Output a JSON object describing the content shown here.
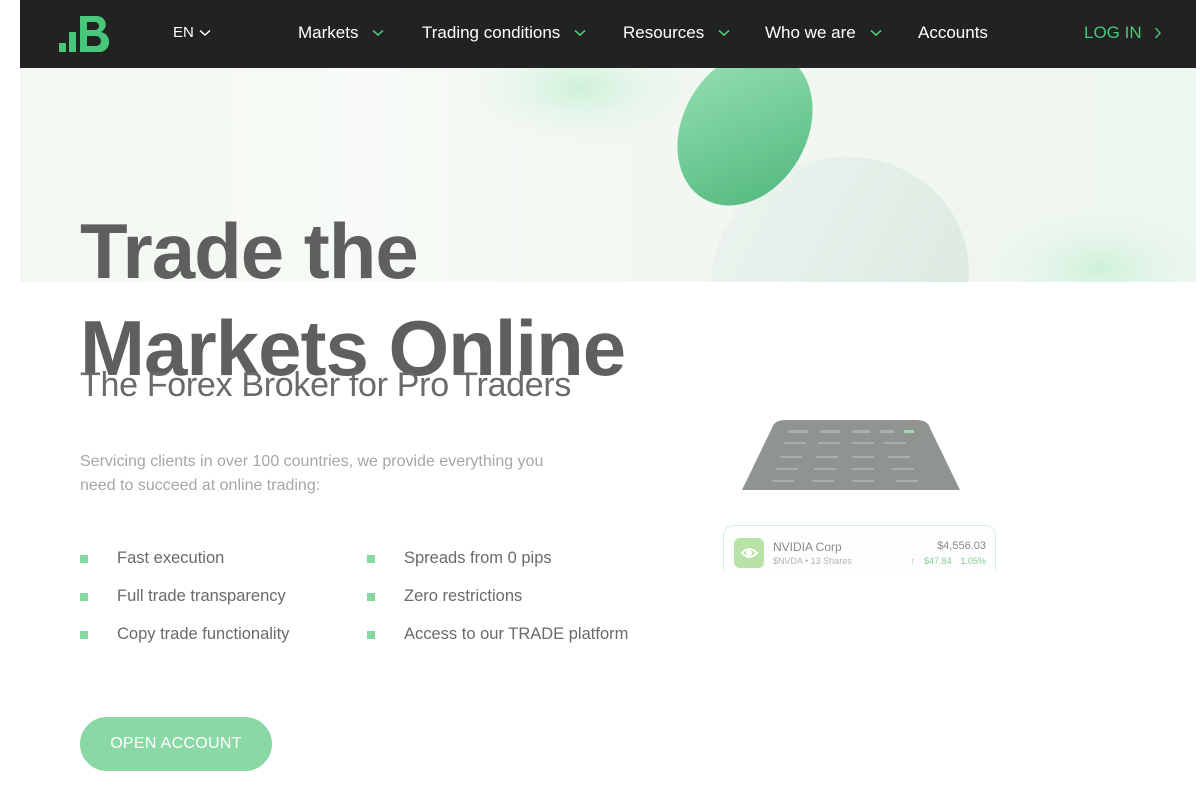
{
  "nav": {
    "lang": "EN",
    "items": [
      {
        "label": "Markets"
      },
      {
        "label": "Trading conditions"
      },
      {
        "label": "Resources"
      },
      {
        "label": "Who we are"
      },
      {
        "label": "Accounts"
      }
    ],
    "login": "LOG IN"
  },
  "hero": {
    "title_line1": "Trade the",
    "title_line2": "Markets Online",
    "subtitle": "The Forex Broker for Pro Traders",
    "description": "Servicing clients in over 100 countries, we provide everything you need to succeed at online trading:",
    "features_left": [
      "Fast execution",
      "Full trade transparency",
      "Copy trade functionality"
    ],
    "features_right": [
      "Spreads from 0 pips",
      "Zero restrictions",
      "Access to our TRADE platform"
    ],
    "cta": "OPEN ACCOUNT"
  },
  "stock_card": {
    "name": "NVIDIA Corp",
    "sub": "$NVDA • 13 Shares",
    "price": "$4,556.03",
    "change": "$47.84",
    "change_pct": "1.05%"
  },
  "colors": {
    "accent": "#47c77a",
    "navbar_bg": "#222222",
    "button_bg": "#8ad8a3"
  }
}
